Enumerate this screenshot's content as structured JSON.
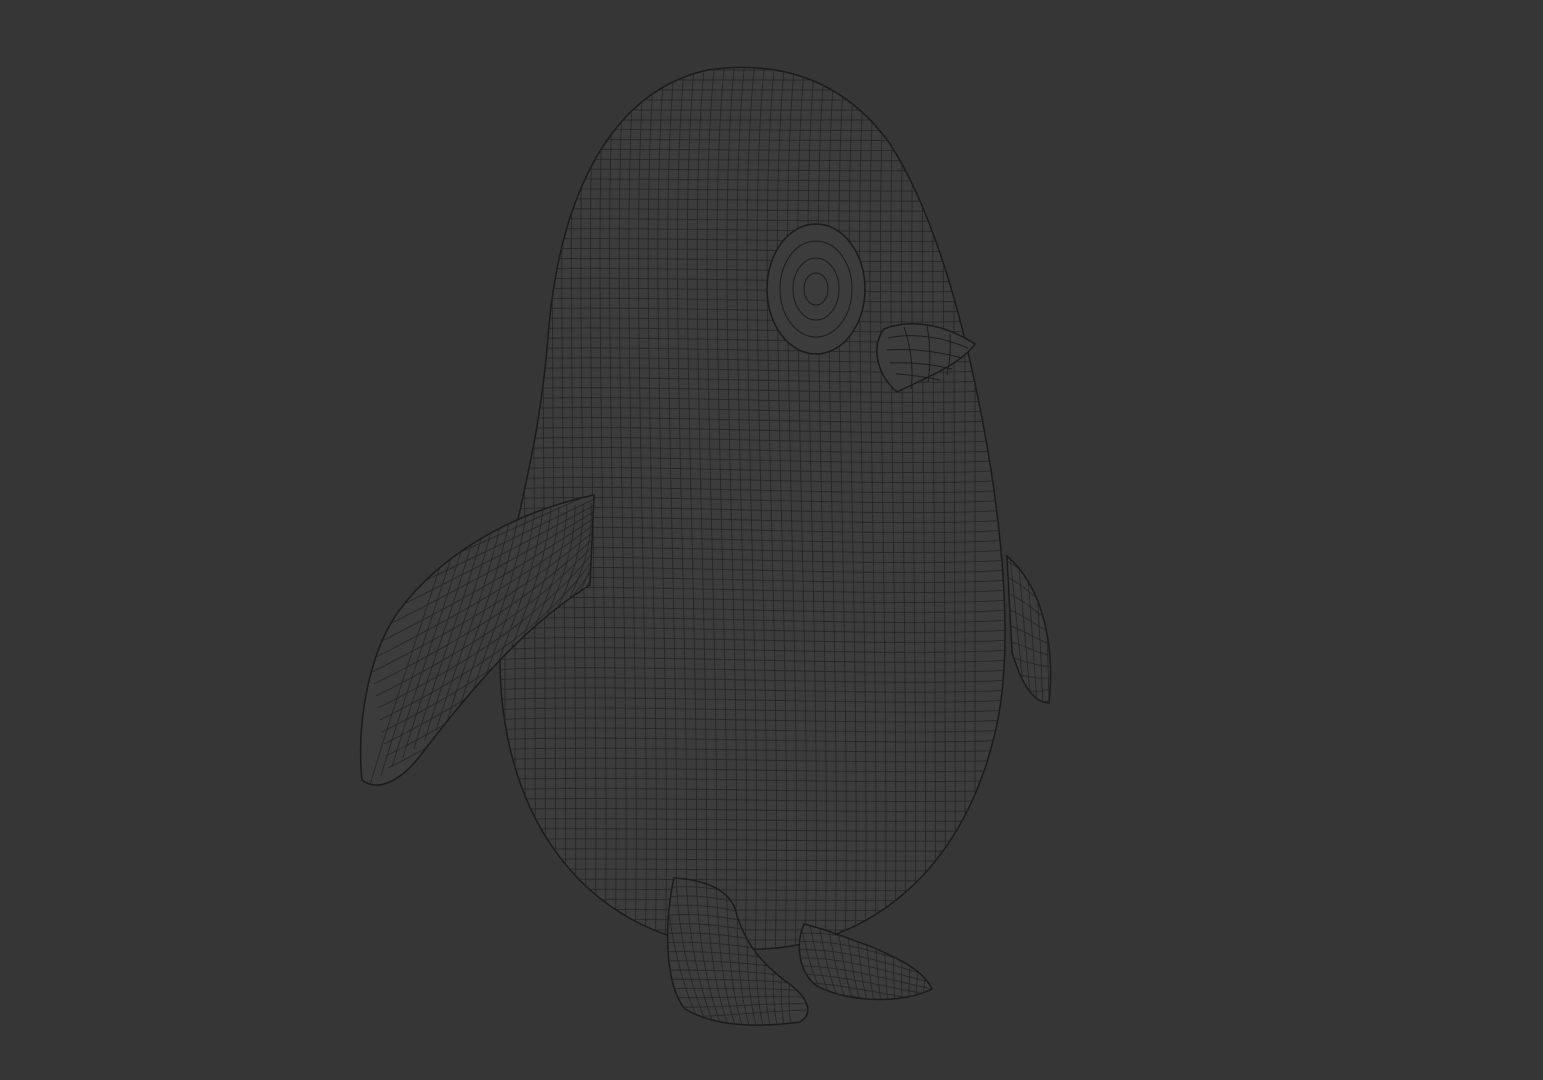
{
  "viewport": {
    "background": "#363636",
    "wire_color": "#1d1d1d",
    "surface_color": "#3c3c3c"
  },
  "model": {
    "subject": "penguin",
    "display_mode": "wireframe"
  }
}
